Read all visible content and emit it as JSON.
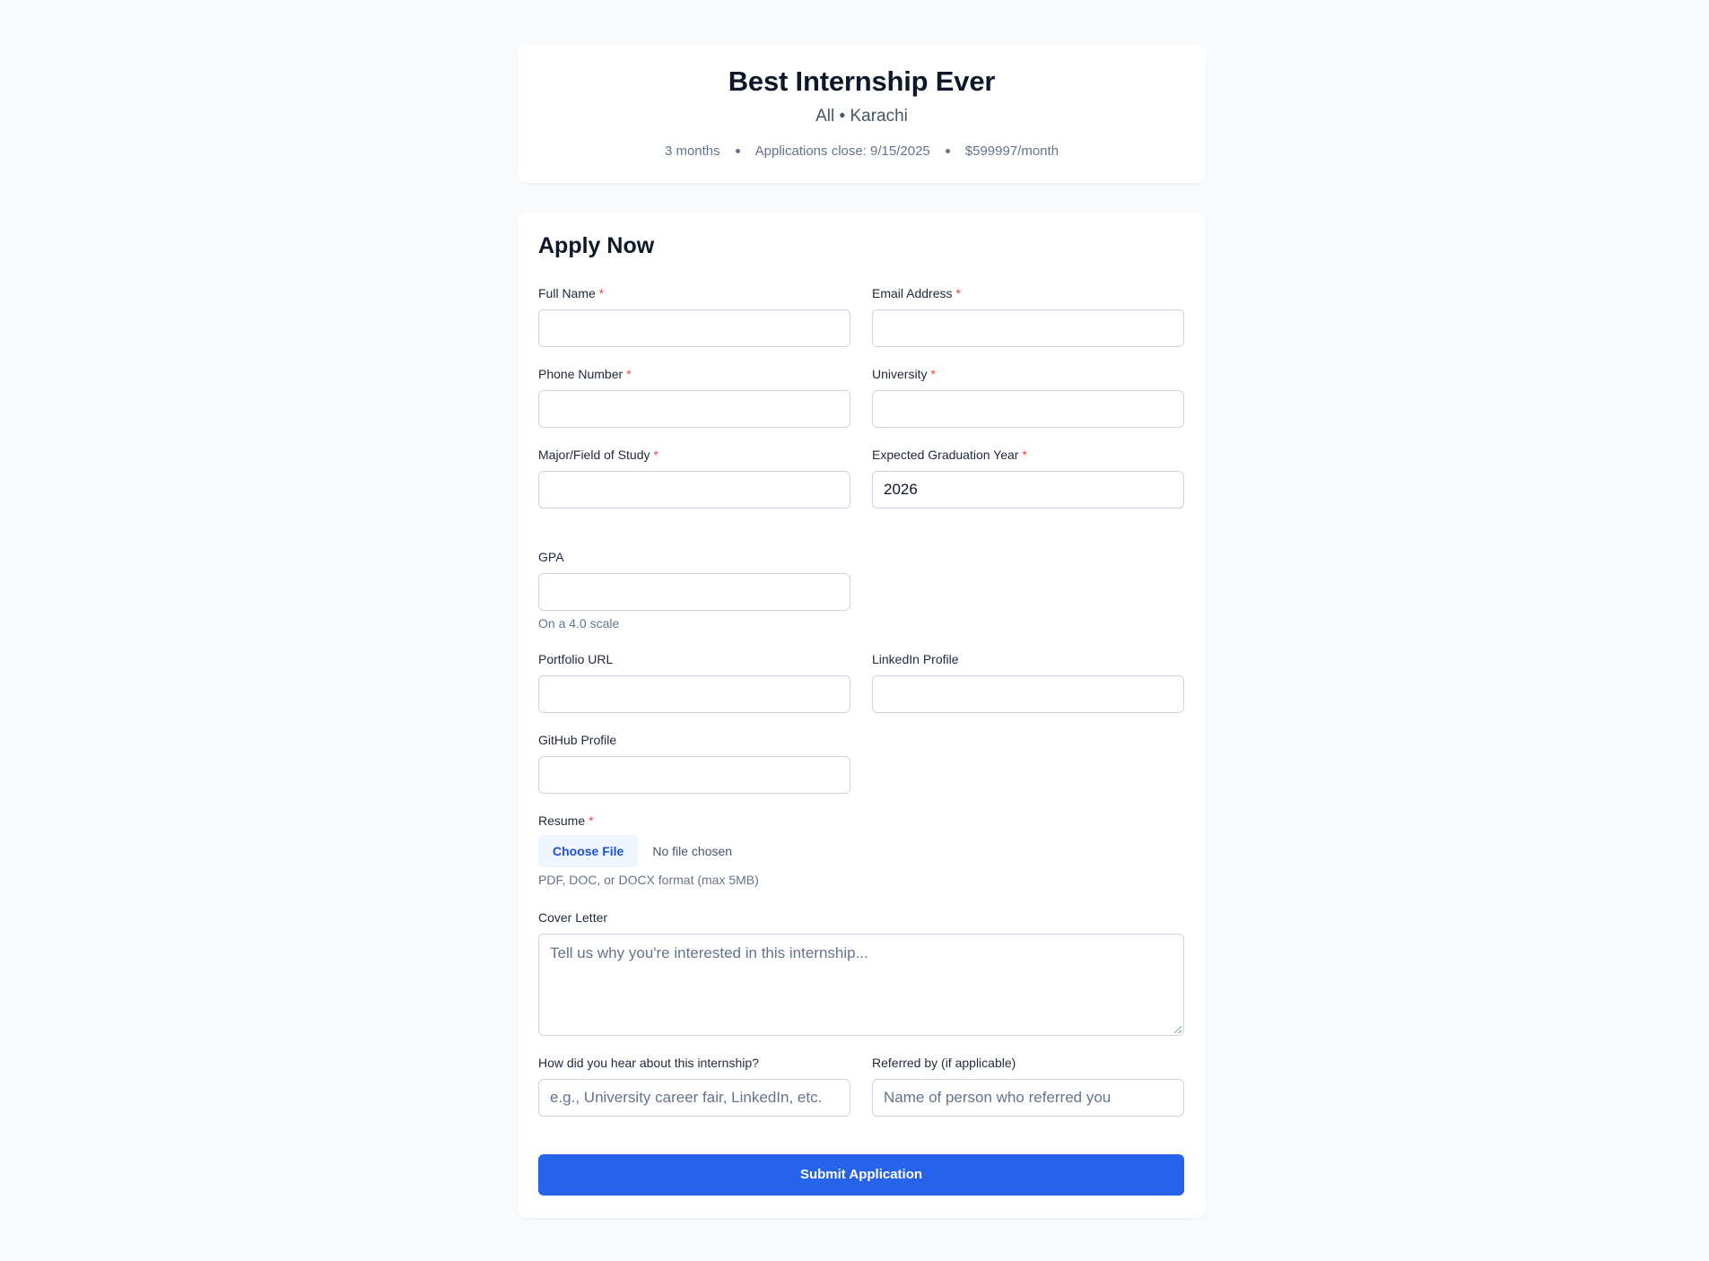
{
  "header": {
    "title": "Best Internship Ever",
    "subtitle": "All • Karachi",
    "duration": "3 months",
    "deadline": "Applications close: 9/15/2025",
    "stipend": "$599997/month"
  },
  "form": {
    "title": "Apply Now",
    "required_mark": "*",
    "full_name": {
      "label": "Full Name",
      "value": ""
    },
    "email": {
      "label": "Email Address",
      "value": ""
    },
    "phone": {
      "label": "Phone Number",
      "value": ""
    },
    "university": {
      "label": "University",
      "value": ""
    },
    "major": {
      "label": "Major/Field of Study",
      "value": ""
    },
    "graduation_year": {
      "label": "Expected Graduation Year",
      "value": "2026"
    },
    "gpa": {
      "label": "GPA",
      "value": "",
      "help": "On a 4.0 scale"
    },
    "portfolio": {
      "label": "Portfolio URL",
      "value": ""
    },
    "linkedin": {
      "label": "LinkedIn Profile",
      "value": ""
    },
    "github": {
      "label": "GitHub Profile",
      "value": ""
    },
    "resume": {
      "label": "Resume",
      "button": "Choose File",
      "status": "No file chosen",
      "help": "PDF, DOC, or DOCX format (max 5MB)"
    },
    "cover_letter": {
      "label": "Cover Letter",
      "placeholder": "Tell us why you're interested in this internship..."
    },
    "source": {
      "label": "How did you hear about this internship?",
      "placeholder": "e.g., University career fair, LinkedIn, etc."
    },
    "referred_by": {
      "label": "Referred by (if applicable)",
      "placeholder": "Name of person who referred you"
    },
    "submit_label": "Submit Application"
  },
  "colors": {
    "background": "#f8fafc",
    "card": "#ffffff",
    "primary": "#2563eb",
    "required": "#ef4444",
    "muted_text": "#64748b"
  }
}
